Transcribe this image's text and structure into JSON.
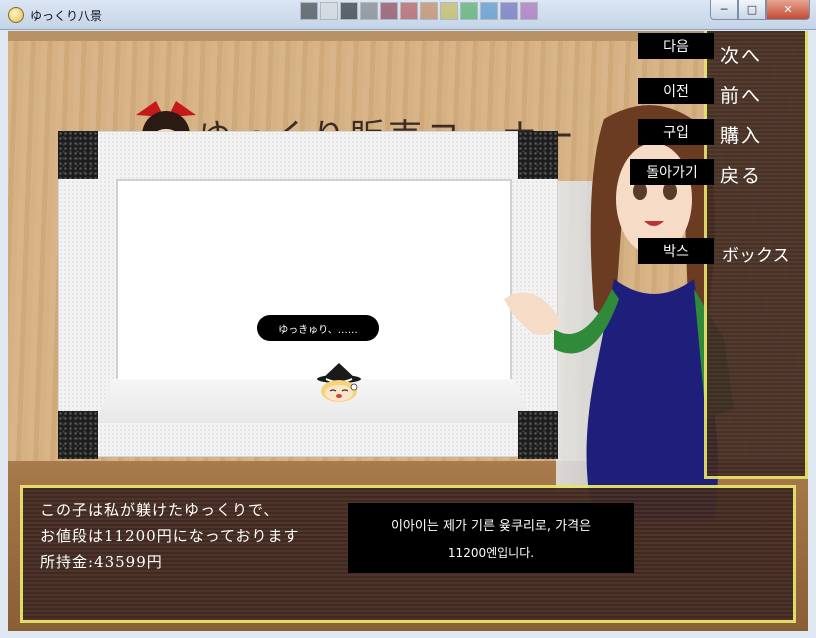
{
  "window": {
    "title": "ゆっくり八景"
  },
  "scene": {
    "shop_sign": "ゆっくり販売コーナー",
    "speech_bubble": "ゆっきゅり、……"
  },
  "menu": {
    "items": [
      {
        "jp": "次へ",
        "ko": "다음"
      },
      {
        "jp": "前へ",
        "ko": "이전"
      },
      {
        "jp": "購入",
        "ko": "구입"
      },
      {
        "jp": "戻る",
        "ko": "돌아가기"
      },
      {
        "jp": "ボックス",
        "ko": "박스"
      }
    ]
  },
  "dialog": {
    "line1": "この子は私が躾けたゆっくりで、",
    "line2": "お値段は11200円になっております",
    "money": "所持金:43599円",
    "ko_line1": "이아이는 제가 기른 윶쿠리로, 가격은",
    "ko_line2": "11200엔입니다."
  },
  "colors": {
    "panel_border": "#e6e36a",
    "panel_bg": "#3b2720"
  }
}
